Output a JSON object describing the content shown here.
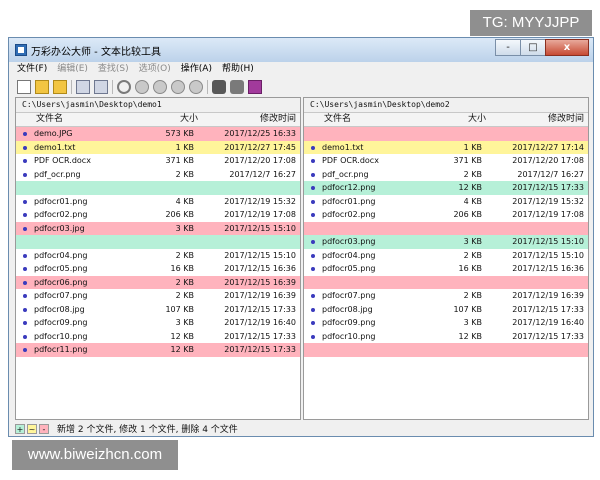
{
  "watermarks": {
    "top": "TG: MYYJJPP",
    "bottom": "www.biweizhcn.com"
  },
  "window": {
    "title": "万彩办公大师 - 文本比较工具",
    "controls": {
      "minimize": "-",
      "maximize": "□",
      "close": "x"
    }
  },
  "menu": [
    {
      "label": "文件(F)",
      "enabled": true
    },
    {
      "label": "编辑(E)",
      "enabled": false
    },
    {
      "label": "查找(S)",
      "enabled": false
    },
    {
      "label": "选项(O)",
      "enabled": false
    },
    {
      "label": "操作(A)",
      "enabled": true
    },
    {
      "label": "帮助(H)",
      "enabled": true
    }
  ],
  "toolbar_icons": [
    "new-icon",
    "open-folder-icon",
    "open-folder-alt-icon",
    "save-icon",
    "save-as-icon",
    "refresh-icon",
    "prev-diff-icon",
    "next-diff-icon",
    "first-diff-icon",
    "last-diff-icon",
    "find-icon",
    "find-next-icon",
    "help-book-icon"
  ],
  "columns": {
    "name": "文件名",
    "size": "大小",
    "date": "修改时间"
  },
  "left": {
    "path": "C:\\Users\\jasmin\\Desktop\\demo1",
    "rows": [
      {
        "name": "demo.JPG",
        "size": "573 KB",
        "date": "2017/12/25 16:33",
        "status": "del"
      },
      {
        "name": "demo1.txt",
        "size": "1 KB",
        "date": "2017/12/27 17:45",
        "status": "mod"
      },
      {
        "name": "PDF OCR.docx",
        "size": "371 KB",
        "date": "2017/12/20 17:08",
        "status": "same"
      },
      {
        "name": "pdf_ocr.png",
        "size": "2 KB",
        "date": "2017/12/7 16:27",
        "status": "same"
      },
      {
        "name": "",
        "size": "",
        "date": "",
        "status": "blank-add"
      },
      {
        "name": "pdfocr01.png",
        "size": "4 KB",
        "date": "2017/12/19 15:32",
        "status": "same"
      },
      {
        "name": "pdfocr02.png",
        "size": "206 KB",
        "date": "2017/12/19 17:08",
        "status": "same"
      },
      {
        "name": "pdfocr03.jpg",
        "size": "3 KB",
        "date": "2017/12/15 15:10",
        "status": "del"
      },
      {
        "name": "",
        "size": "",
        "date": "",
        "status": "blank-add"
      },
      {
        "name": "pdfocr04.png",
        "size": "2 KB",
        "date": "2017/12/15 15:10",
        "status": "same"
      },
      {
        "name": "pdfocr05.png",
        "size": "16 KB",
        "date": "2017/12/15 16:36",
        "status": "same"
      },
      {
        "name": "pdfocr06.png",
        "size": "2 KB",
        "date": "2017/12/15 16:39",
        "status": "del"
      },
      {
        "name": "pdfocr07.png",
        "size": "2 KB",
        "date": "2017/12/19 16:39",
        "status": "same"
      },
      {
        "name": "pdfocr08.jpg",
        "size": "107 KB",
        "date": "2017/12/15 17:33",
        "status": "same"
      },
      {
        "name": "pdfocr09.png",
        "size": "3 KB",
        "date": "2017/12/19 16:40",
        "status": "same"
      },
      {
        "name": "pdfocr10.png",
        "size": "12 KB",
        "date": "2017/12/15 17:33",
        "status": "same"
      },
      {
        "name": "pdfocr11.png",
        "size": "12 KB",
        "date": "2017/12/15 17:33",
        "status": "del"
      }
    ]
  },
  "right": {
    "path": "C:\\Users\\jasmin\\Desktop\\demo2",
    "rows": [
      {
        "name": "",
        "size": "",
        "date": "",
        "status": "blank-del"
      },
      {
        "name": "demo1.txt",
        "size": "1 KB",
        "date": "2017/12/27 17:14",
        "status": "mod"
      },
      {
        "name": "PDF OCR.docx",
        "size": "371 KB",
        "date": "2017/12/20 17:08",
        "status": "same"
      },
      {
        "name": "pdf_ocr.png",
        "size": "2 KB",
        "date": "2017/12/7 16:27",
        "status": "same"
      },
      {
        "name": "pdfocr12.png",
        "size": "12 KB",
        "date": "2017/12/15 17:33",
        "status": "add"
      },
      {
        "name": "pdfocr01.png",
        "size": "4 KB",
        "date": "2017/12/19 15:32",
        "status": "same"
      },
      {
        "name": "pdfocr02.png",
        "size": "206 KB",
        "date": "2017/12/19 17:08",
        "status": "same"
      },
      {
        "name": "",
        "size": "",
        "date": "",
        "status": "blank-del"
      },
      {
        "name": "pdfocr03.png",
        "size": "3 KB",
        "date": "2017/12/15 15:10",
        "status": "add"
      },
      {
        "name": "pdfocr04.png",
        "size": "2 KB",
        "date": "2017/12/15 15:10",
        "status": "same"
      },
      {
        "name": "pdfocr05.png",
        "size": "16 KB",
        "date": "2017/12/15 16:36",
        "status": "same"
      },
      {
        "name": "",
        "size": "",
        "date": "",
        "status": "blank-del"
      },
      {
        "name": "pdfocr07.png",
        "size": "2 KB",
        "date": "2017/12/19 16:39",
        "status": "same"
      },
      {
        "name": "pdfocr08.jpg",
        "size": "107 KB",
        "date": "2017/12/15 17:33",
        "status": "same"
      },
      {
        "name": "pdfocr09.png",
        "size": "3 KB",
        "date": "2017/12/19 16:40",
        "status": "same"
      },
      {
        "name": "pdfocr10.png",
        "size": "12 KB",
        "date": "2017/12/15 17:33",
        "status": "same"
      },
      {
        "name": "",
        "size": "",
        "date": "",
        "status": "blank-del"
      }
    ]
  },
  "status": {
    "legend": [
      {
        "symbol": "+",
        "color": "#b6f0d8"
      },
      {
        "symbol": "~",
        "color": "#fff59a"
      },
      {
        "symbol": "-",
        "color": "#ffb3bd"
      }
    ],
    "text": "新增 2 个文件, 修改 1 个文件, 删除 4 个文件"
  },
  "colors": {
    "deleted": "#ffb3bd",
    "modified": "#fff59a",
    "added": "#b6f0d8",
    "bullet": "#3b3bbd"
  }
}
